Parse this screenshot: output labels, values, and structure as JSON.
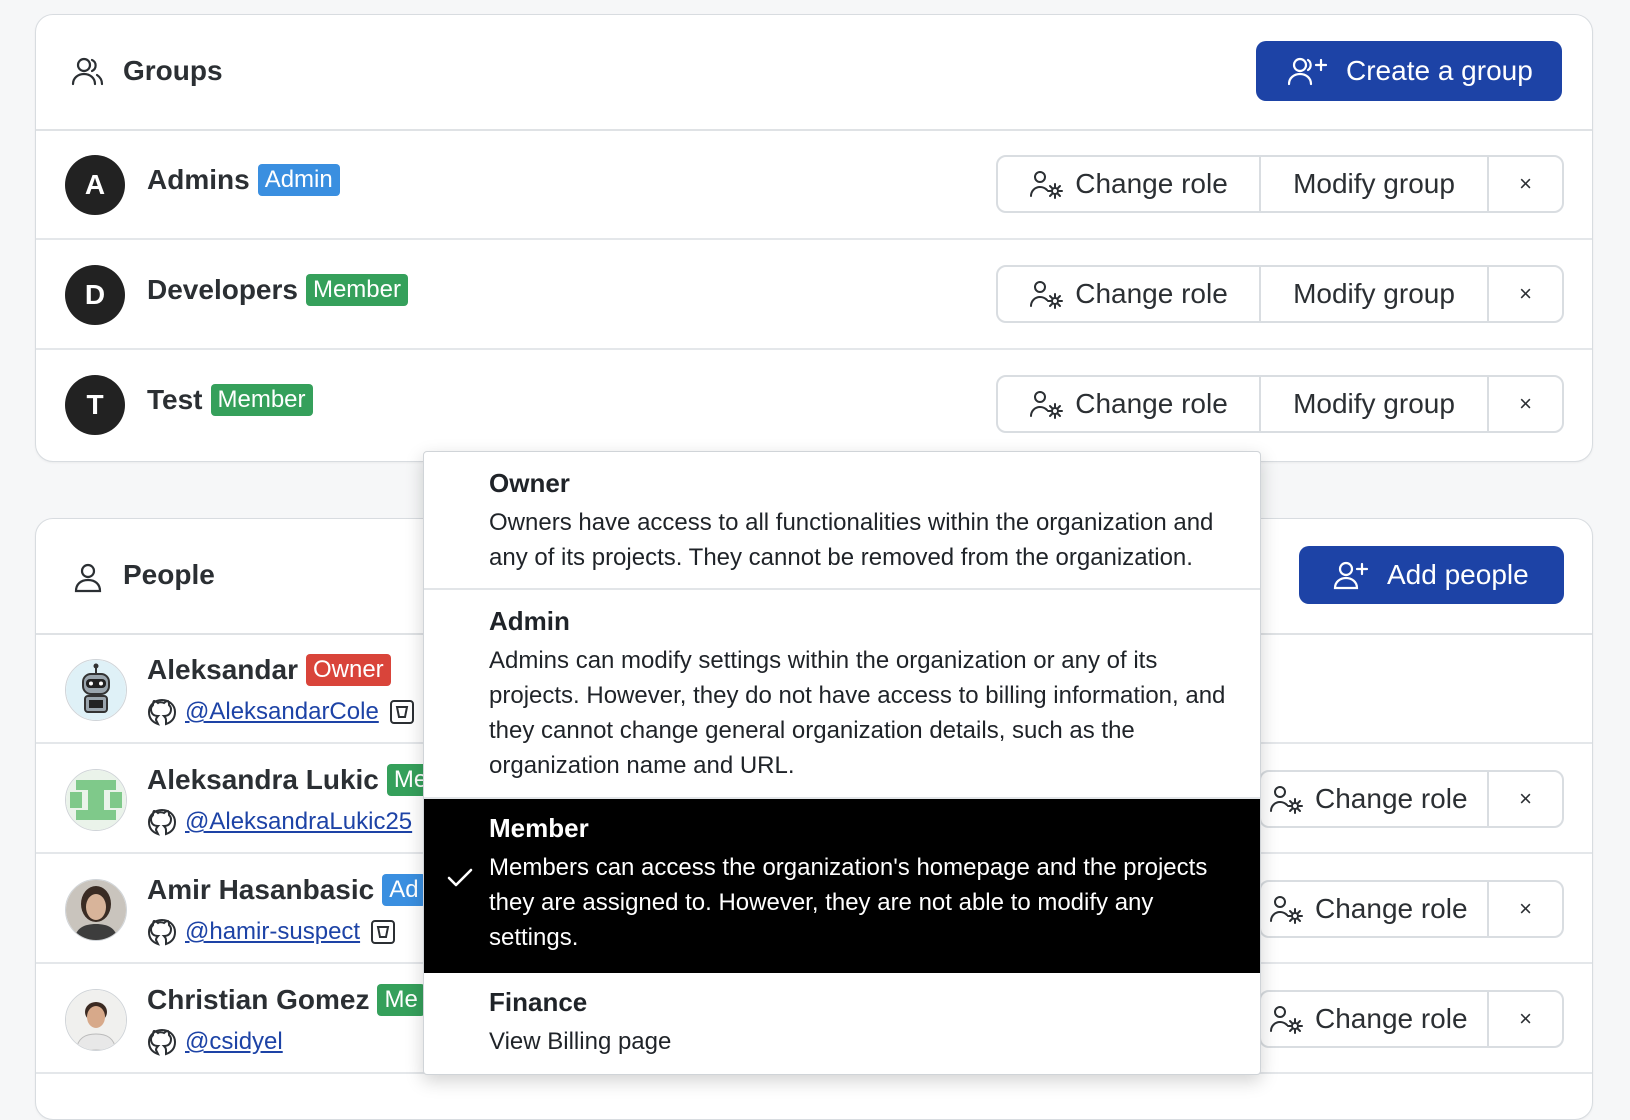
{
  "groups": {
    "title": "Groups",
    "create_button": "Create a group",
    "rows": [
      {
        "initial": "A",
        "name": "Admins",
        "role": "Admin"
      },
      {
        "initial": "D",
        "name": "Developers",
        "role": "Member"
      },
      {
        "initial": "T",
        "name": "Test",
        "role": "Member"
      }
    ],
    "change_role": "Change role",
    "modify_group": "Modify group",
    "remove": "×"
  },
  "people": {
    "title": "People",
    "add_button": "Add people",
    "rows": [
      {
        "name": "Aleksandar",
        "role": "Owner",
        "handle": "@AleksandarCole"
      },
      {
        "name": "Aleksandra Lukic",
        "role": "Me",
        "handle": "@AleksandraLukic25"
      },
      {
        "name": "Amir Hasanbasic",
        "role": "Ad",
        "handle": "@hamir-suspect"
      },
      {
        "name": "Christian Gomez",
        "role": "Me",
        "handle": "@csidyel"
      }
    ],
    "change_role": "Change role",
    "remove": "×"
  },
  "role_menu": {
    "items": [
      {
        "title": "Owner",
        "description": "Owners have access to all functionalities within the organization and any of its projects. They cannot be removed from the organization.",
        "selected": false
      },
      {
        "title": "Admin",
        "description": "Admins can modify settings within the organization or any of its projects. However, they do not have access to billing information, and they cannot change general organization details, such as the organization name and URL.",
        "selected": false
      },
      {
        "title": "Member",
        "description": "Members can access the organization's homepage and the projects they are assigned to. However, they are not able to modify any settings.",
        "selected": true
      },
      {
        "title": "Finance",
        "description": "View Billing page",
        "selected": false
      }
    ]
  },
  "colors": {
    "primary": "#1d43a6",
    "admin_badge": "#3a8fe0",
    "member_badge": "#35a05b",
    "owner_badge": "#d9443a"
  }
}
